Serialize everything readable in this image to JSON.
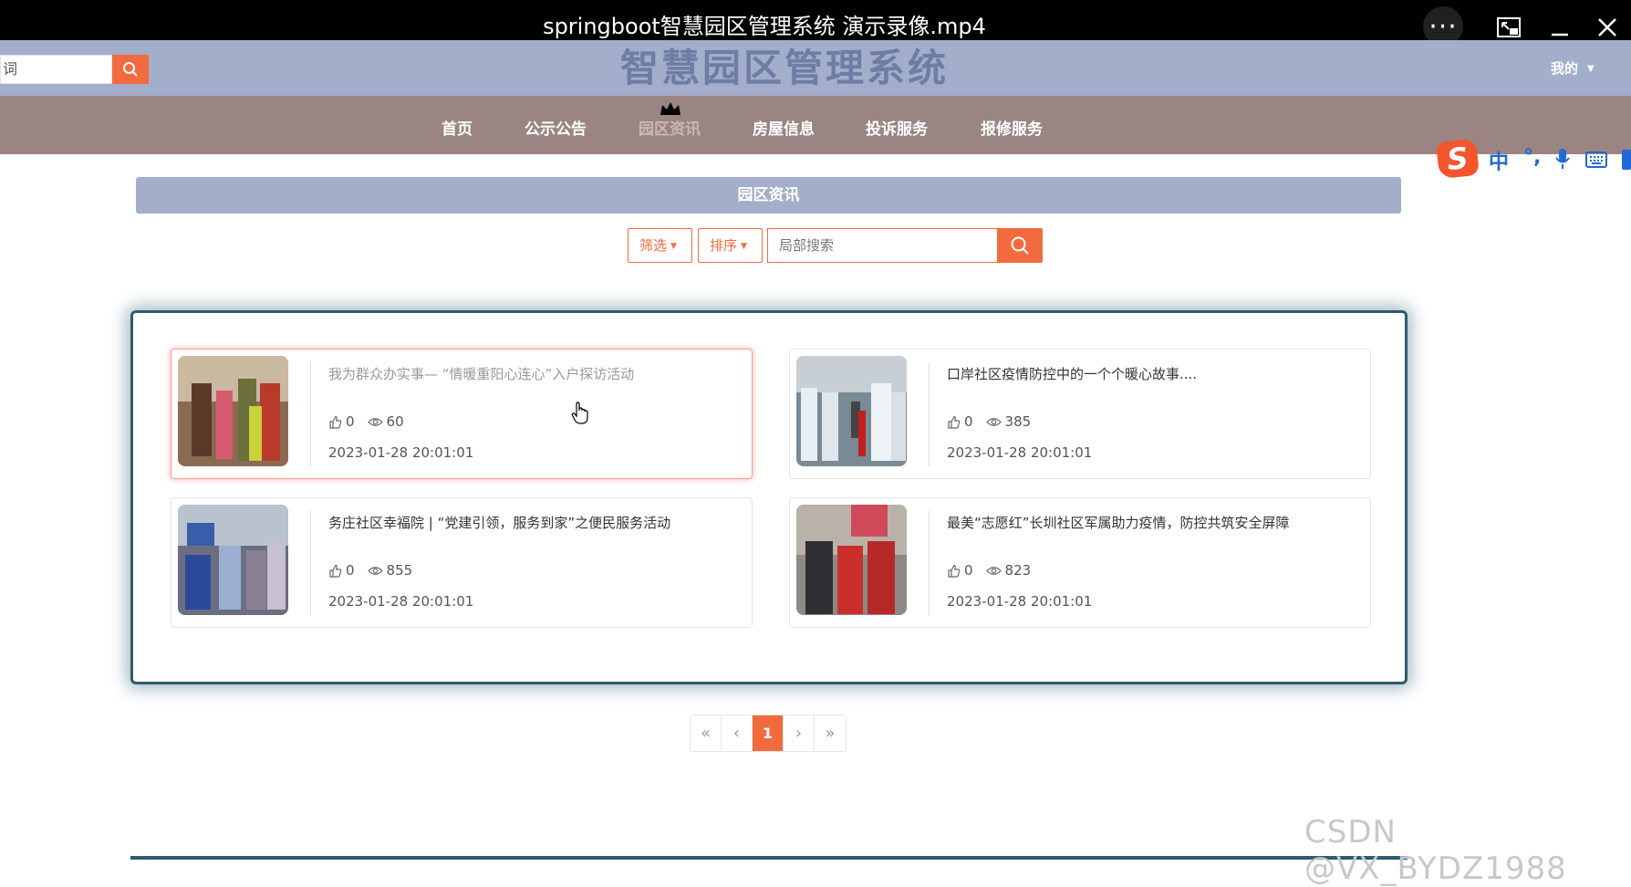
{
  "player": {
    "title": "springboot智慧园区管理系统 演示录像.mp4",
    "more_label": "···",
    "controls": [
      "more-icon",
      "pip-icon",
      "minimize-icon",
      "close-icon"
    ]
  },
  "header": {
    "search_value": "词",
    "site_title": "智慧园区管理系统",
    "my_menu": "我的"
  },
  "nav": {
    "items": [
      {
        "label": "首页",
        "active": false
      },
      {
        "label": "公示公告",
        "active": false
      },
      {
        "label": "园区资讯",
        "active": true
      },
      {
        "label": "房屋信息",
        "active": false
      },
      {
        "label": "投诉服务",
        "active": false
      },
      {
        "label": "报修服务",
        "active": false
      }
    ]
  },
  "ime": {
    "logo": "S",
    "items": [
      "中",
      "°,",
      "mic-icon",
      "keyboard-icon"
    ]
  },
  "section": {
    "title": "园区资讯"
  },
  "filters": {
    "filter_label": "筛选",
    "sort_label": "排序",
    "search_placeholder": "局部搜索"
  },
  "news": [
    {
      "title": "我为群众办实事— “情暖重阳心连心”入户探访活动",
      "likes": "0",
      "views": "60",
      "date": "2023-01-28 20:01:01",
      "hover": true
    },
    {
      "title": "口岸社区疫情防控中的一个个暖心故事....",
      "likes": "0",
      "views": "385",
      "date": "2023-01-28 20:01:01",
      "hover": false
    },
    {
      "title": "务庄社区幸福院 | “党建引领，服务到家”之便民服务活动",
      "likes": "0",
      "views": "855",
      "date": "2023-01-28 20:01:01",
      "hover": false
    },
    {
      "title": "最美“志愿红”长圳社区军属助力疫情，防控共筑安全屏障",
      "likes": "0",
      "views": "823",
      "date": "2023-01-28 20:01:01",
      "hover": false
    }
  ],
  "pagination": {
    "first": "«",
    "prev": "‹",
    "current": "1",
    "next": "›",
    "last": "»"
  },
  "watermark": "CSDN @VX_BYDZ1988",
  "colors": {
    "accent": "#f26b3e",
    "header_bg": "#a3aecb",
    "nav_bg": "#9a8583",
    "panel_border": "#2d5b6d"
  }
}
